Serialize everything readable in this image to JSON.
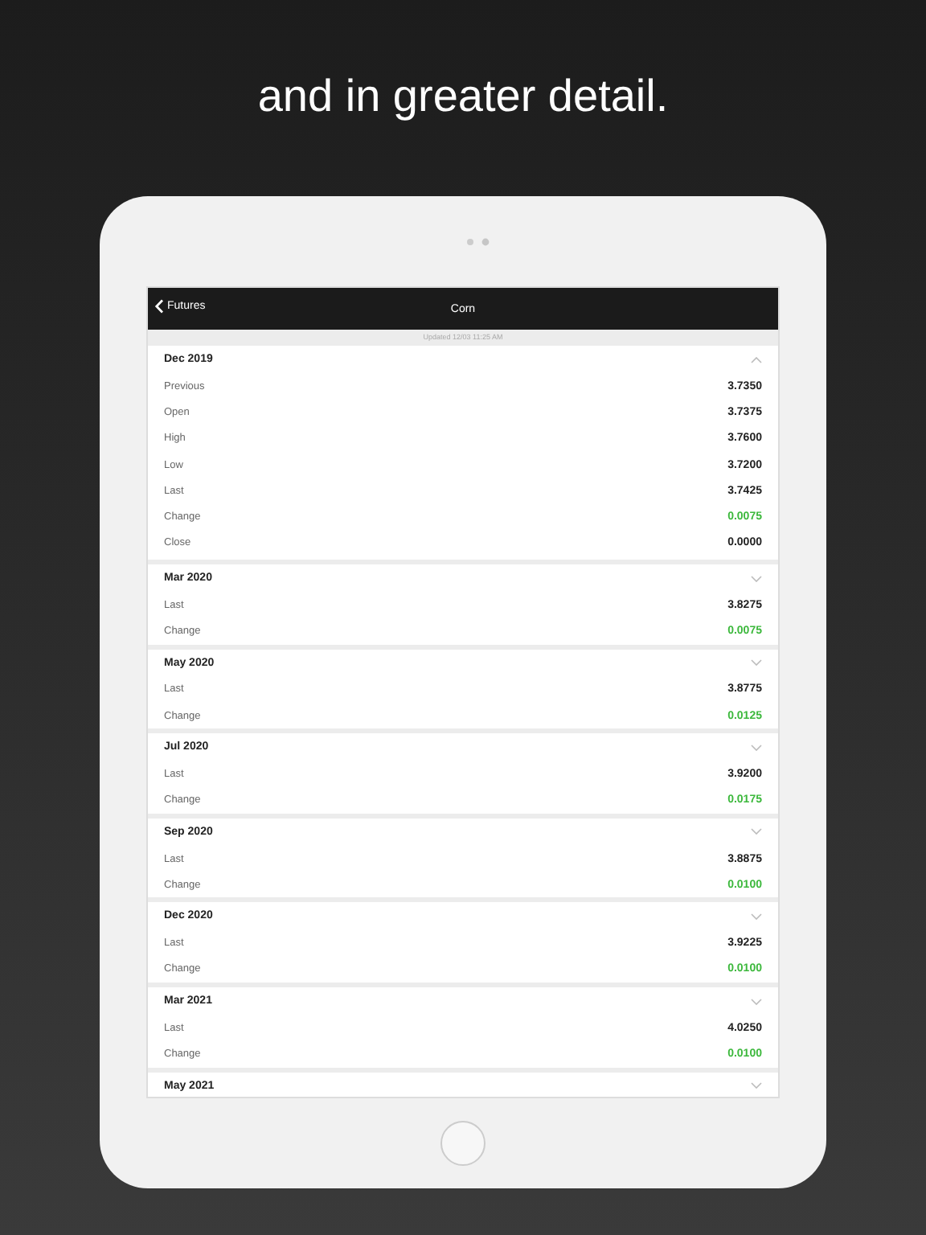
{
  "headline": "and in greater detail.",
  "nav": {
    "back": "Futures",
    "title": "Corn"
  },
  "updated": "Updated 12/03 11:25 AM",
  "sections": [
    {
      "title": "Dec 2019",
      "expanded": true,
      "rows": [
        {
          "label": "Previous",
          "value": "3.7350"
        },
        {
          "label": "Open",
          "value": "3.7375"
        },
        {
          "label": "High",
          "value": "3.7600"
        },
        {
          "label": "Low",
          "value": "3.7200"
        },
        {
          "label": "Last",
          "value": "3.7425"
        },
        {
          "label": "Change",
          "value": "0.0075",
          "color": "#3cb83c"
        },
        {
          "label": "Close",
          "value": "0.0000"
        }
      ]
    },
    {
      "title": "Mar 2020",
      "expanded": false,
      "rows": [
        {
          "label": "Last",
          "value": "3.8275"
        },
        {
          "label": "Change",
          "value": "0.0075",
          "color": "#3cb83c"
        }
      ]
    },
    {
      "title": "May 2020",
      "expanded": false,
      "rows": [
        {
          "label": "Last",
          "value": "3.8775"
        },
        {
          "label": "Change",
          "value": "0.0125",
          "color": "#3cb83c"
        }
      ]
    },
    {
      "title": "Jul 2020",
      "expanded": false,
      "rows": [
        {
          "label": "Last",
          "value": "3.9200"
        },
        {
          "label": "Change",
          "value": "0.0175",
          "color": "#3cb83c"
        }
      ]
    },
    {
      "title": "Sep 2020",
      "expanded": false,
      "rows": [
        {
          "label": "Last",
          "value": "3.8875"
        },
        {
          "label": "Change",
          "value": "0.0100",
          "color": "#3cb83c"
        }
      ]
    },
    {
      "title": "Dec 2020",
      "expanded": false,
      "rows": [
        {
          "label": "Last",
          "value": "3.9225"
        },
        {
          "label": "Change",
          "value": "0.0100",
          "color": "#3cb83c"
        }
      ]
    },
    {
      "title": "Mar 2021",
      "expanded": false,
      "rows": [
        {
          "label": "Last",
          "value": "4.0250"
        },
        {
          "label": "Change",
          "value": "0.0100",
          "color": "#3cb83c"
        }
      ]
    },
    {
      "title": "May 2021",
      "expanded": false
    }
  ]
}
